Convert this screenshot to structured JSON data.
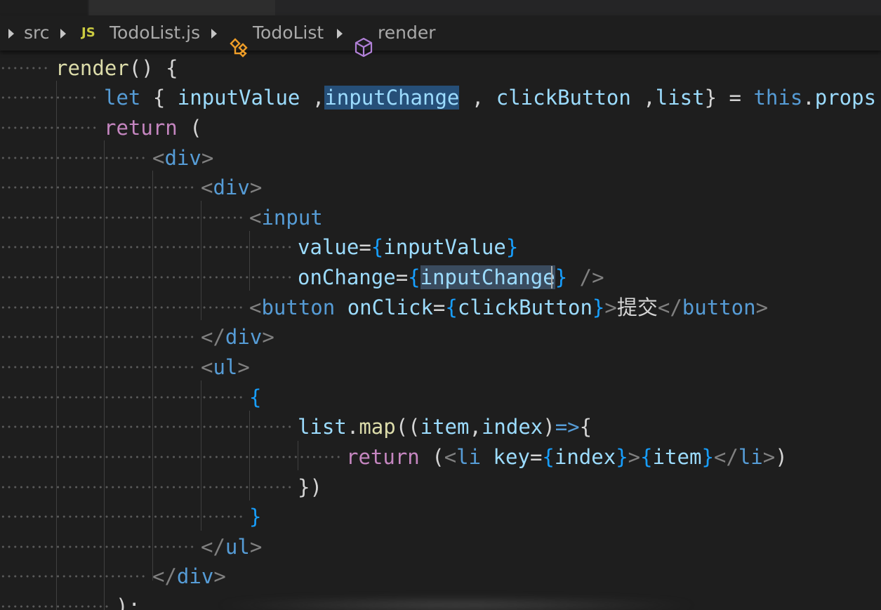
{
  "breadcrumb": {
    "folder": "src",
    "file_badge": "JS",
    "file": "TodoList.js",
    "component": "TodoList",
    "method": "render"
  },
  "code": {
    "lines": [
      {
        "id": "l1",
        "tokens": [
          [
            "render",
            "fn"
          ],
          [
            "()",
            "text"
          ],
          [
            " {",
            "text"
          ]
        ]
      },
      {
        "id": "l2",
        "tokens": [
          [
            "let",
            "kw"
          ],
          [
            " { ",
            "text"
          ],
          [
            "inputValue",
            "var"
          ],
          [
            " ,",
            "text"
          ],
          [
            "inputChange",
            "var"
          ],
          [
            " , ",
            "text"
          ],
          [
            "clickButton",
            "var"
          ],
          [
            " ,",
            "text"
          ],
          [
            "list",
            "var"
          ],
          [
            "} = ",
            "text"
          ],
          [
            "this",
            "kw"
          ],
          [
            ".",
            "text"
          ],
          [
            "props",
            "var"
          ]
        ]
      },
      {
        "id": "l3",
        "tokens": [
          [
            "return",
            "ctrl"
          ],
          [
            " (",
            "text"
          ]
        ]
      },
      {
        "id": "l4",
        "tokens": [
          [
            "<",
            "punc"
          ],
          [
            "div",
            "tag"
          ],
          [
            ">",
            "punc"
          ]
        ]
      },
      {
        "id": "l5",
        "tokens": [
          [
            "<",
            "punc"
          ],
          [
            "div",
            "tag"
          ],
          [
            ">",
            "punc"
          ]
        ]
      },
      {
        "id": "l6",
        "tokens": [
          [
            "<",
            "punc"
          ],
          [
            "input",
            "tag"
          ]
        ]
      },
      {
        "id": "l7",
        "tokens": [
          [
            "value",
            "var"
          ],
          [
            "=",
            "text"
          ],
          [
            "{",
            "brace"
          ],
          [
            "inputValue",
            "var"
          ],
          [
            "}",
            "brace"
          ]
        ]
      },
      {
        "id": "l8",
        "tokens": [
          [
            "onChange",
            "var"
          ],
          [
            "=",
            "text"
          ],
          [
            "{",
            "brace"
          ],
          [
            "inputChange",
            "var"
          ],
          [
            "}",
            "brace"
          ],
          [
            " ",
            "text"
          ],
          [
            "/>",
            "punc"
          ]
        ]
      },
      {
        "id": "l9",
        "tokens": [
          [
            "<",
            "punc"
          ],
          [
            "button",
            "tag"
          ],
          [
            " ",
            "text"
          ],
          [
            "onClick",
            "var"
          ],
          [
            "=",
            "text"
          ],
          [
            "{",
            "brace"
          ],
          [
            "clickButton",
            "var"
          ],
          [
            "}",
            "brace"
          ],
          [
            ">",
            "punc"
          ],
          [
            "提交",
            "text"
          ],
          [
            "</",
            "punc"
          ],
          [
            "button",
            "tag"
          ],
          [
            ">",
            "punc"
          ]
        ]
      },
      {
        "id": "l10",
        "tokens": [
          [
            "</",
            "punc"
          ],
          [
            "div",
            "tag"
          ],
          [
            ">",
            "punc"
          ]
        ]
      },
      {
        "id": "l11",
        "tokens": [
          [
            "<",
            "punc"
          ],
          [
            "ul",
            "tag"
          ],
          [
            ">",
            "punc"
          ]
        ]
      },
      {
        "id": "l12",
        "tokens": [
          [
            "{",
            "brace"
          ]
        ]
      },
      {
        "id": "l13",
        "tokens": [
          [
            "list",
            "var"
          ],
          [
            ".",
            "text"
          ],
          [
            "map",
            "fn"
          ],
          [
            "((",
            "text"
          ],
          [
            "item",
            "var"
          ],
          [
            ",",
            "text"
          ],
          [
            "index",
            "var"
          ],
          [
            ")",
            "text"
          ],
          [
            "=>",
            "kw"
          ],
          [
            "{",
            "text"
          ]
        ]
      },
      {
        "id": "l14",
        "tokens": [
          [
            "return",
            "ctrl"
          ],
          [
            " (",
            "text"
          ],
          [
            "<",
            "punc"
          ],
          [
            "li",
            "tag"
          ],
          [
            " ",
            "text"
          ],
          [
            "key",
            "var"
          ],
          [
            "=",
            "text"
          ],
          [
            "{",
            "brace"
          ],
          [
            "index",
            "var"
          ],
          [
            "}",
            "brace"
          ],
          [
            ">",
            "punc"
          ],
          [
            "{",
            "brace"
          ],
          [
            "item",
            "var"
          ],
          [
            "}",
            "brace"
          ],
          [
            "</",
            "punc"
          ],
          [
            "li",
            "tag"
          ],
          [
            ">",
            "punc"
          ],
          [
            ")",
            "text"
          ]
        ]
      },
      {
        "id": "l15",
        "tokens": [
          [
            "})",
            "text"
          ]
        ]
      },
      {
        "id": "l16",
        "tokens": [
          [
            "}",
            "brace"
          ]
        ]
      },
      {
        "id": "l17",
        "tokens": [
          [
            "</",
            "punc"
          ],
          [
            "ul",
            "tag"
          ],
          [
            ">",
            "punc"
          ]
        ]
      },
      {
        "id": "l18",
        "tokens": [
          [
            "</",
            "punc"
          ],
          [
            "div",
            "tag"
          ],
          [
            ">",
            "punc"
          ]
        ]
      },
      {
        "id": "l19",
        "tokens": [
          [
            ");",
            "text"
          ]
        ]
      }
    ]
  },
  "colors": {
    "background": "#1e1e1e",
    "selection": "#264f78",
    "word_highlight": "#3a4b5e",
    "keyword": "#569cd6",
    "control": "#c586c0",
    "function": "#dcdcaa",
    "variable": "#9cdcfe",
    "js_badge": "#cbcb41"
  },
  "icons": {
    "component": "symbol-class-icon",
    "method": "symbol-method-icon",
    "separator": "chevron-right-icon"
  }
}
